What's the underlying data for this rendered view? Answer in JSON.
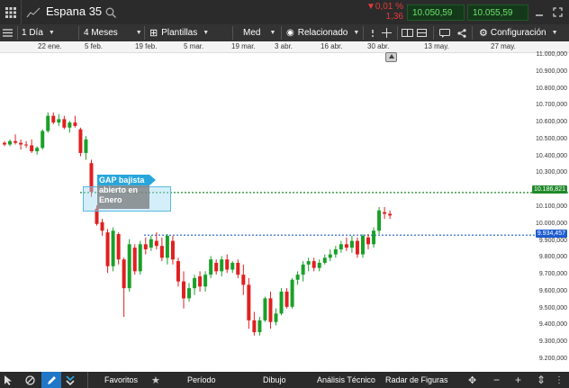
{
  "header": {
    "title": "Espana 35",
    "change_pct": "▼0,01 %",
    "change_abs": "1,36",
    "bid": "10.050,59",
    "ask": "10.055,59"
  },
  "toolbar": {
    "period": "1 Día",
    "range": "4 Meses",
    "templates": "Plantillas",
    "indicator": "Med",
    "related": "Relacionado",
    "settings": "Configuración"
  },
  "xaxis": [
    "22 ene.",
    "5 feb.",
    "19 feb.",
    "5 mar.",
    "19 mar.",
    "3 abr.",
    "16 abr.",
    "30 abr.",
    "13 may.",
    "27 may."
  ],
  "yaxis": [
    "11.000,000",
    "10.900,000",
    "10.800,000",
    "10.700,000",
    "10.600,000",
    "10.500,000",
    "10.400,000",
    "10.300,000",
    "10.200,000",
    "10.100,000",
    "10.000,000",
    "9.900,000",
    "9.800,000",
    "9.700,000",
    "9.600,000",
    "9.500,000",
    "9.400,000",
    "9.300,000",
    "9.200,000"
  ],
  "levels": {
    "upper": "10.186,821",
    "lower": "9.934,457"
  },
  "annotation": "GAP bajista abierto en Enero",
  "bottom": {
    "favorites": "Favoritos",
    "period": "Período",
    "drawing": "Dibujo",
    "technical": "Análisis Técnico",
    "patterns": "Radar de Figuras"
  },
  "chart_data": {
    "type": "candlestick",
    "ylim": [
      9200,
      11000
    ],
    "candles": [
      [
        10480,
        10490,
        10460,
        10470
      ],
      [
        10470,
        10500,
        10460,
        10490
      ],
      [
        10490,
        10530,
        10470,
        10480
      ],
      [
        10480,
        10500,
        10440,
        10470
      ],
      [
        10470,
        10490,
        10450,
        10465
      ],
      [
        10465,
        10500,
        10420,
        10430
      ],
      [
        10430,
        10460,
        10410,
        10450
      ],
      [
        10450,
        10560,
        10440,
        10550
      ],
      [
        10550,
        10660,
        10540,
        10640
      ],
      [
        10640,
        10660,
        10590,
        10600
      ],
      [
        10600,
        10650,
        10580,
        10620
      ],
      [
        10620,
        10640,
        10560,
        10570
      ],
      [
        10570,
        10610,
        10540,
        10600
      ],
      [
        10600,
        10640,
        10570,
        10580
      ],
      [
        10560,
        10570,
        10400,
        10420
      ],
      [
        10420,
        10520,
        10380,
        10500
      ],
      [
        10360,
        10380,
        10160,
        10190
      ],
      [
        10090,
        10110,
        9990,
        10000
      ],
      [
        10010,
        10030,
        9930,
        9960
      ],
      [
        9950,
        9970,
        9710,
        9750
      ],
      [
        9750,
        9980,
        9720,
        9960
      ],
      [
        9940,
        9950,
        9760,
        9790
      ],
      [
        9790,
        9800,
        9450,
        9620
      ],
      [
        9620,
        9910,
        9600,
        9880
      ],
      [
        9860,
        9880,
        9700,
        9720
      ],
      [
        9720,
        9900,
        9700,
        9880
      ],
      [
        9880,
        9920,
        9820,
        9850
      ],
      [
        9860,
        9930,
        9840,
        9910
      ],
      [
        9900,
        9950,
        9850,
        9870
      ],
      [
        9870,
        9920,
        9780,
        9800
      ],
      [
        9800,
        9940,
        9760,
        9930
      ],
      [
        9900,
        9930,
        9760,
        9790
      ],
      [
        9780,
        9800,
        9630,
        9660
      ],
      [
        9660,
        9720,
        9500,
        9560
      ],
      [
        9560,
        9650,
        9540,
        9620
      ],
      [
        9620,
        9700,
        9580,
        9680
      ],
      [
        9690,
        9720,
        9600,
        9630
      ],
      [
        9630,
        9720,
        9600,
        9700
      ],
      [
        9700,
        9810,
        9680,
        9790
      ],
      [
        9770,
        9790,
        9700,
        9720
      ],
      [
        9720,
        9810,
        9690,
        9790
      ],
      [
        9790,
        9820,
        9710,
        9730
      ],
      [
        9730,
        9780,
        9710,
        9770
      ],
      [
        9770,
        9790,
        9680,
        9700
      ],
      [
        9700,
        9760,
        9580,
        9640
      ],
      [
        9640,
        9680,
        9380,
        9430
      ],
      [
        9430,
        9480,
        9340,
        9360
      ],
      [
        9360,
        9450,
        9340,
        9430
      ],
      [
        9430,
        9570,
        9420,
        9560
      ],
      [
        9560,
        9600,
        9380,
        9420
      ],
      [
        9420,
        9500,
        9400,
        9470
      ],
      [
        9470,
        9620,
        9460,
        9600
      ],
      [
        9600,
        9620,
        9500,
        9510
      ],
      [
        9510,
        9680,
        9500,
        9670
      ],
      [
        9670,
        9720,
        9640,
        9700
      ],
      [
        9700,
        9780,
        9660,
        9760
      ],
      [
        9760,
        9800,
        9720,
        9780
      ],
      [
        9780,
        9800,
        9720,
        9740
      ],
      [
        9740,
        9790,
        9720,
        9770
      ],
      [
        9770,
        9820,
        9760,
        9800
      ],
      [
        9800,
        9850,
        9780,
        9820
      ],
      [
        9820,
        9870,
        9800,
        9850
      ],
      [
        9850,
        9900,
        9830,
        9880
      ],
      [
        9880,
        9920,
        9840,
        9860
      ],
      [
        9860,
        9930,
        9830,
        9900
      ],
      [
        9900,
        9920,
        9800,
        9820
      ],
      [
        9820,
        9940,
        9800,
        9930
      ],
      [
        9920,
        9940,
        9850,
        9880
      ],
      [
        9880,
        9980,
        9860,
        9960
      ],
      [
        9960,
        10100,
        9940,
        10080
      ],
      [
        10070,
        10100,
        10030,
        10060
      ],
      [
        10060,
        10080,
        10030,
        10050
      ]
    ]
  }
}
